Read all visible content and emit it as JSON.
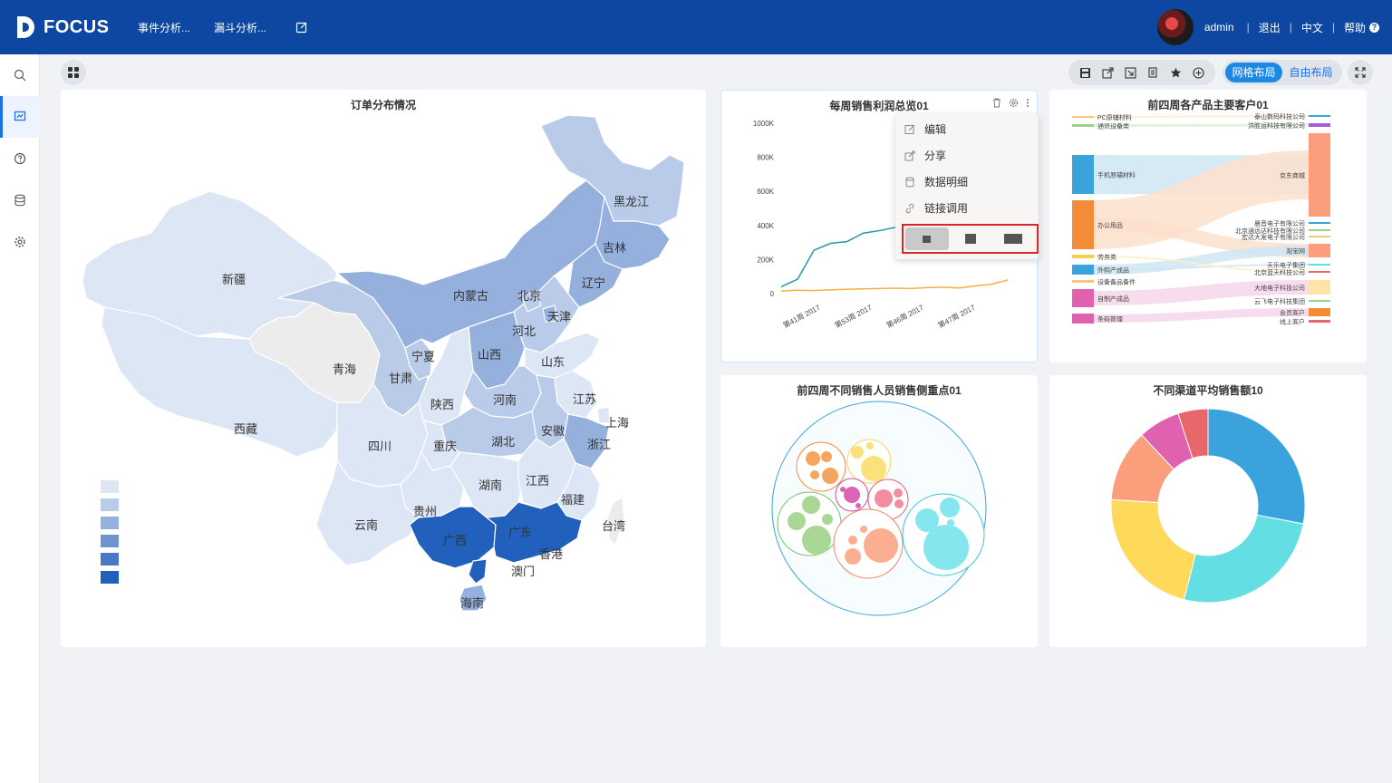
{
  "app": {
    "logo_text": "FOCUS",
    "nav": [
      "事件分析...",
      "漏斗分析..."
    ],
    "user": "admin",
    "logout": "退出",
    "lang": "中文",
    "help": "帮助",
    "help_icon": "?"
  },
  "sidebar": {
    "items": [
      "search-icon",
      "dashboard-icon",
      "help-icon",
      "database-icon",
      "settings-icon"
    ]
  },
  "toolbar": {
    "icons": [
      "save-icon",
      "share-icon",
      "export-icon",
      "copy-icon",
      "star-icon",
      "add-icon"
    ],
    "layout_grid": "网格布局",
    "layout_free": "自由布局"
  },
  "map_panel": {
    "title": "订单分布情况",
    "provinces": [
      "新疆",
      "西藏",
      "青海",
      "甘肃",
      "宁夏",
      "内蒙古",
      "黑龙江",
      "吉林",
      "辽宁",
      "北京",
      "天津",
      "河北",
      "山西",
      "山东",
      "陕西",
      "河南",
      "江苏",
      "上海",
      "安徽",
      "湖北",
      "浙江",
      "四川",
      "重庆",
      "湖南",
      "江西",
      "福建",
      "贵州",
      "云南",
      "广西",
      "广东",
      "香港",
      "澳门",
      "海南",
      "台湾"
    ],
    "legend_colors": [
      "#dde6f4",
      "#b9cbe8",
      "#95b0dc",
      "#6f93cf",
      "#4a77c3",
      "#2260bd"
    ]
  },
  "line_panel": {
    "title": "每周销售利润总览01",
    "menu": [
      "编辑",
      "分享",
      "数据明细",
      "链接调用"
    ],
    "chart_data": {
      "type": "line",
      "x": [
        "第41周 2017",
        "第53周 2017",
        "第46周 2017",
        "第47周 2017"
      ],
      "yticks": [
        "1000K",
        "800K",
        "600K",
        "400K",
        "200K",
        "0"
      ],
      "ylim": [
        0,
        1000000
      ],
      "series": [
        {
          "color": "#1e9aa8",
          "values": [
            40000,
            85000,
            255000,
            295000,
            305000,
            355000,
            370000,
            390000,
            400000
          ]
        },
        {
          "color": "#f5b041",
          "values": [
            15000,
            20000,
            18000,
            22000,
            25000,
            28000,
            30000,
            32000,
            30000,
            35000,
            38000,
            33000,
            45000,
            55000,
            80000
          ]
        }
      ]
    }
  },
  "sankey_panel": {
    "title": "前四周各产品主要客户01",
    "left_labels": [
      "PC原辅材料",
      "通讯设备类",
      "手机原辅材料",
      "办公用品",
      "劳务类",
      "外购产成品",
      "设备备品备件",
      "自制产成品",
      "条码管理"
    ],
    "right_labels": [
      "泰山数码科技公司",
      "洪胜运科技有限公司",
      "京东商城",
      "晨音电子有限公司",
      "北京通远达科技有限公司",
      "宏达大发电子有限公司",
      "淘宝网",
      "天乐电子集团",
      "北京蓝天科技公司",
      "大地电子科技公司",
      "云飞电子科技集团",
      "会员客户",
      "线上客户"
    ]
  },
  "bubble_panel": {
    "title": "前四周不同销售人员销售侧重点01"
  },
  "donut_panel": {
    "title": "不同渠道平均销售额10",
    "chart_data": {
      "type": "pie",
      "values": [
        28,
        26,
        22,
        12,
        7,
        5
      ],
      "colors": [
        "#3aa3dc",
        "#63dfe3",
        "#ffd95a",
        "#fb9e7c",
        "#e062ae",
        "#e7676a"
      ]
    }
  }
}
